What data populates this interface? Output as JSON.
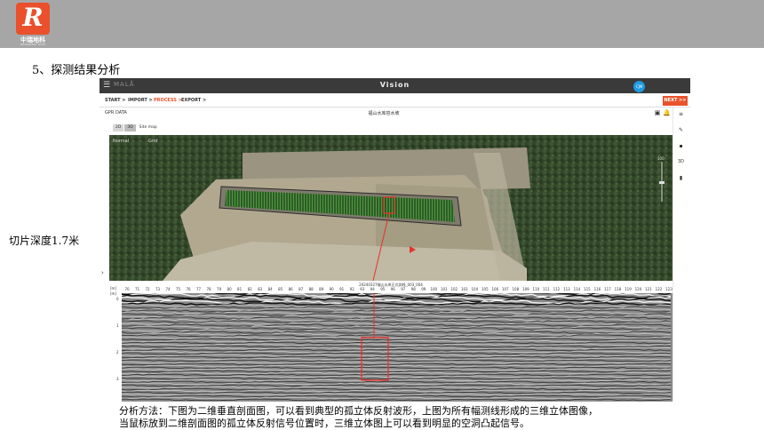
{
  "slide": {
    "section_title": "5、探测结果分析",
    "side_label": "切片深度1.7米",
    "caption_lines": [
      "分析方法：下图为二维垂直剖面图，可以看到典型的孤立体反射波形，上图为所有幅测线形成的三维立体图像，",
      "当鼠标放到二维剖面图的孤立体反射信号位置时，三维立体图上可以看到明显的空洞凸起信号。"
    ],
    "logo": {
      "letter": "R",
      "cn": "中瑞地科",
      "en": "ZHONGRUI DIKE"
    }
  },
  "app": {
    "brand": "MALÅ",
    "title": "Vision",
    "avatar_initials": "CJM",
    "steps": [
      {
        "label": "START >",
        "active": false
      },
      {
        "label": "IMPORT >",
        "active": false
      },
      {
        "label": "PROCESS >",
        "active": true
      },
      {
        "label": "EXPORT >",
        "active": false
      }
    ],
    "next_label": "NEXT >>",
    "section_label": "GPR DATA",
    "project_name": "福山水库容水坡",
    "view_toggle": [
      "2D",
      "3D",
      "Site map"
    ],
    "selected_view": "3D",
    "map_tools": [
      "Normal",
      "Grid"
    ],
    "depth_zoom_top": "100",
    "profile_title": "20240327福山水库正式测线_003_004",
    "x_axis_unit": "[m]",
    "y_axis_unit": "[m]",
    "x_ticks": [
      "70",
      "71",
      "72",
      "73",
      "74",
      "75",
      "76",
      "77",
      "78",
      "79",
      "80",
      "81",
      "82",
      "83",
      "84",
      "85",
      "86",
      "87",
      "88",
      "89",
      "90",
      "91",
      "92",
      "93",
      "94",
      "95",
      "96",
      "97",
      "98",
      "99",
      "100",
      "101",
      "102",
      "103",
      "104",
      "105",
      "106",
      "107",
      "108",
      "109",
      "110",
      "111",
      "112",
      "113",
      "114",
      "115",
      "116",
      "117",
      "118",
      "119",
      "120",
      "121",
      "122",
      "123"
    ],
    "y_ticks": [
      "0",
      "1",
      "2",
      "3"
    ],
    "colors": {
      "accent": "#e9532c",
      "titlebar": "#3a3a3a",
      "avatar": "#1e9be0",
      "marker": "#e8322a"
    },
    "icons": {
      "menu": "hamburger-icon",
      "toolbar": [
        "screenshot-icon",
        "bell-icon"
      ],
      "right_panel": [
        "layers-icon",
        "pin-icon",
        "legend-icon",
        "3d-icon",
        "export-icon"
      ]
    }
  }
}
